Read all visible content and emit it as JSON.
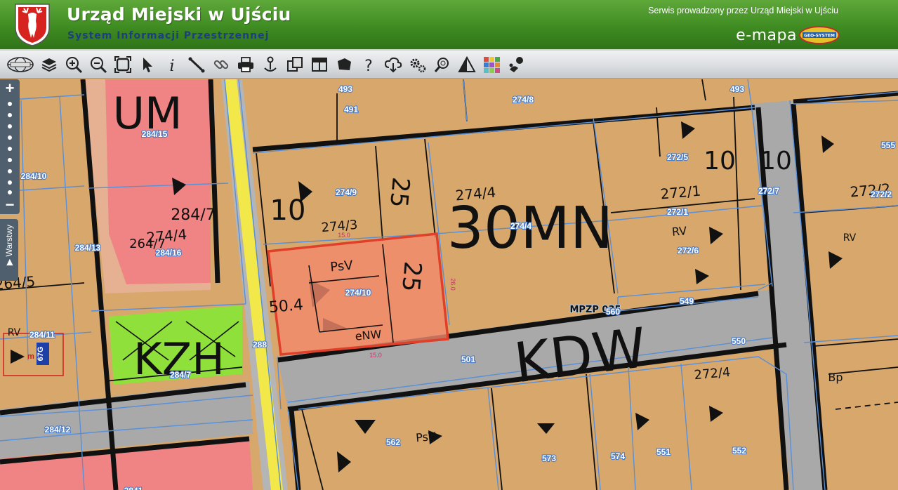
{
  "header": {
    "title": "Urząd Miejski w Ujściu",
    "subtitle": "System Informacji Przestrzennej",
    "service_note": "Serwis prowadzony przez Urząd Miejski w Ujściu",
    "emapa_label": "e-mapa",
    "geo_badge_text": "GEO-SYSTEM"
  },
  "toolbar": {
    "tools": [
      {
        "name": "globe-button",
        "icon": "globe-icon"
      },
      {
        "name": "layers-button",
        "icon": "layers-icon"
      },
      {
        "name": "zoom-in-button",
        "icon": "zoom-in-icon"
      },
      {
        "name": "zoom-out-button",
        "icon": "zoom-out-icon"
      },
      {
        "name": "full-extent-button",
        "icon": "full-extent-icon"
      },
      {
        "name": "select-button",
        "icon": "arrow-pointer-icon"
      },
      {
        "name": "info-button",
        "icon": "info-icon"
      },
      {
        "name": "measure-distance-button",
        "icon": "ruler-icon"
      },
      {
        "name": "link-button",
        "icon": "link-icon"
      },
      {
        "name": "print-button",
        "icon": "printer-icon"
      },
      {
        "name": "pin-button",
        "icon": "pin-icon"
      },
      {
        "name": "copy-button",
        "icon": "copy-icon"
      },
      {
        "name": "layout-button",
        "icon": "layout-icon"
      },
      {
        "name": "area-button",
        "icon": "polygon-icon"
      },
      {
        "name": "help-button",
        "icon": "question-icon"
      },
      {
        "name": "download-button",
        "icon": "cloud-download-icon"
      },
      {
        "name": "settings-button",
        "icon": "gears-icon"
      },
      {
        "name": "search-button",
        "icon": "magnifier-icon"
      },
      {
        "name": "warning-button",
        "icon": "warning-icon"
      },
      {
        "name": "color-palette-button",
        "icon": "palette-icon"
      },
      {
        "name": "street-view-button",
        "icon": "street-view-icon"
      }
    ]
  },
  "map_controls": {
    "zoom_in": "+",
    "zoom_out": "−",
    "layers_tab": "▶ Warstwy"
  },
  "colors": {
    "header_green": "#3f8c22",
    "subtitle_blue": "#1c3f7e",
    "mn_zone": "#d7a76b",
    "u_zone": "#f08484",
    "green_zone": "#8fe03a",
    "road": "#a9a9a9",
    "highway_yellow": "#f2e84a",
    "parcel_line": "#5a8fd6",
    "selection": "#e0402a"
  },
  "map": {
    "parcel_labels": [
      "493",
      "274/8",
      "493",
      "491",
      "284/15",
      "272/5",
      "555",
      "284/10",
      "274/9",
      "272/1",
      "272/7",
      "272/2",
      "284/13",
      "284/16",
      "274/4",
      "272/6",
      "274/10",
      "549",
      "560",
      "284/11",
      "288",
      "550",
      "284/7",
      "501",
      "284/12",
      "562",
      "573",
      "574",
      "551",
      "552",
      "2841"
    ],
    "zone_labels": [
      "UM",
      "30MN",
      "KZH",
      "KDW",
      "MPZP 035"
    ],
    "plan_labels": [
      "274/4",
      "274/3",
      "10",
      "25",
      "50.4",
      "PsV",
      "25",
      "eNW",
      "274/4",
      "10",
      "10",
      "RV",
      "272/1",
      "272/2",
      "272/4",
      "RV",
      "Bp",
      "PsV",
      "264/7",
      "264/5",
      "RV",
      "284/7"
    ],
    "dim_labels": [
      "15.0",
      "26.0",
      "15.0"
    ],
    "marker_labels": [
      "67G",
      "m"
    ],
    "selected_parcel": "274/10"
  }
}
